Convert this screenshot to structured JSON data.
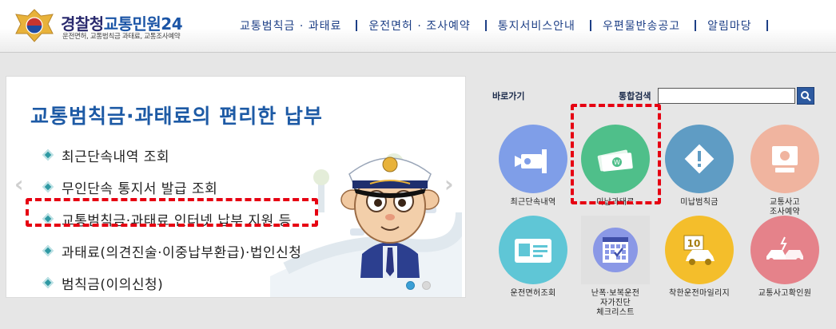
{
  "header": {
    "logo_title_1": "경찰청",
    "logo_title_2": "교통민원24",
    "logo_sub": "운전면허, 교통범칙금 과태료, 교통조사예약",
    "nav": [
      "교통범칙금 · 과태료",
      "운전면허 · 조사예약",
      "통지서비스안내",
      "우편물반송공고",
      "알림마당"
    ]
  },
  "banner": {
    "title": "교통범칙금·과태료의 편리한 납부",
    "items": [
      "최근단속내역 조회",
      "무인단속 통지서 발급 조회",
      "교통범칙금·과태료 인터넷 납부 지원 등",
      "과태료(의견진술·이중납부환급)·법인신청",
      "범칙금(이의신청)"
    ],
    "arrow_left": "‹",
    "arrow_right": "›"
  },
  "quick": {
    "label": "바로가기",
    "search_label": "통합검색",
    "search_value": "",
    "tiles": [
      {
        "label": "최근단속내역",
        "icon": "camera-icon",
        "color": "#7f9ee8"
      },
      {
        "label": "미납과태료",
        "icon": "money-icon",
        "color": "#4fbf8a"
      },
      {
        "label": "미납범칙금",
        "icon": "warning-sign-icon",
        "color": "#5f9cc4"
      },
      {
        "label": "교통사고\n조사예약",
        "icon": "computer-icon",
        "color": "#f0b49f"
      },
      {
        "label": "운전면허조회",
        "icon": "license-card-icon",
        "color": "#5fc6d6"
      },
      {
        "label": "난폭·보복운전\n자가진단\n체크리스트",
        "icon": "calendar-check-icon",
        "color": "#8a98e6"
      },
      {
        "label": "착한운전마일리지",
        "icon": "mileage-car-icon",
        "color": "#f4be2b"
      },
      {
        "label": "교통사고확인원",
        "icon": "car-crash-icon",
        "color": "#e5828a"
      }
    ]
  }
}
